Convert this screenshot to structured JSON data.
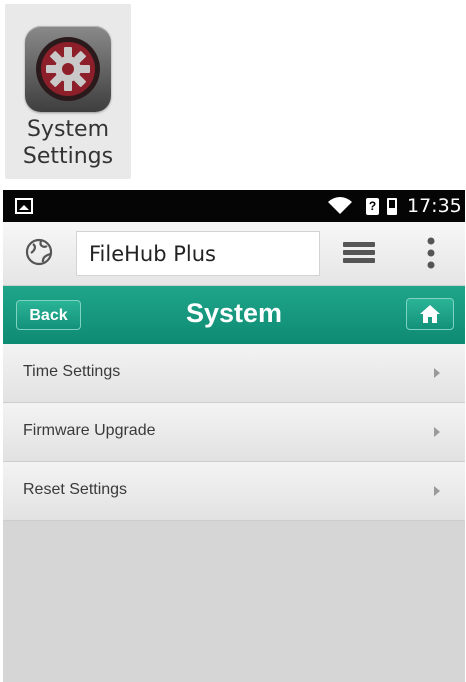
{
  "app_tile": {
    "icon": "gear-icon",
    "label_line1": "System",
    "label_line2": "Settings"
  },
  "statusbar": {
    "time": "17:35",
    "icons": [
      "image-icon",
      "wifi-icon",
      "sim-icon",
      "battery-icon"
    ],
    "sim_text": "?"
  },
  "toolbar": {
    "app_name": "FileHub Plus",
    "icons": [
      "globe-icon",
      "menu-lines-icon",
      "more-dots-icon"
    ]
  },
  "header": {
    "back_label": "Back",
    "title": "System",
    "home_icon": "home-icon",
    "accent_color": "#13917a"
  },
  "menu": {
    "items": [
      {
        "label": "Time Settings"
      },
      {
        "label": "Firmware Upgrade"
      },
      {
        "label": "Reset Settings"
      }
    ]
  }
}
